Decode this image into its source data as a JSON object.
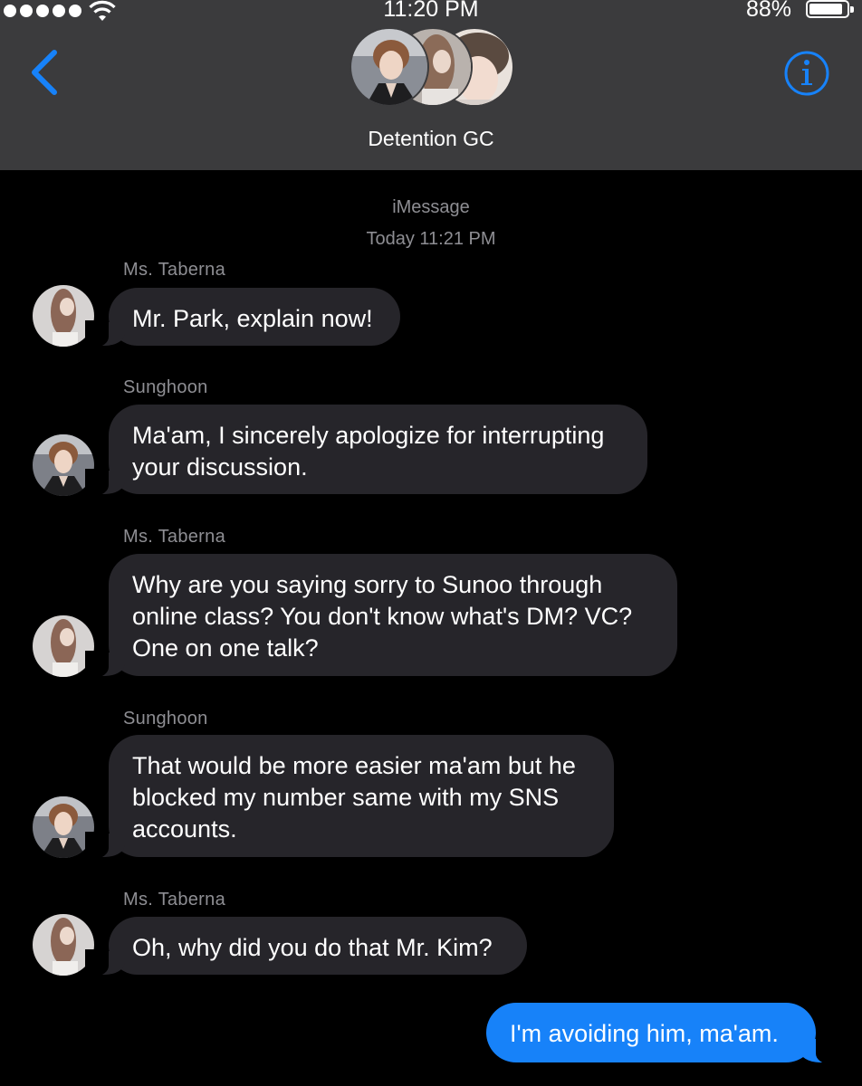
{
  "status_bar": {
    "time": "11:20 PM",
    "battery_percent": "88%"
  },
  "nav": {
    "back_icon": "chevron-left-icon",
    "info_icon": "info-icon",
    "accent_color": "#1782f9"
  },
  "chat": {
    "title": "Detention GC",
    "service": "iMessage",
    "timestamp": "Today 11:21 PM"
  },
  "messages": [
    {
      "sender": "Ms. Taberna",
      "text": "Mr. Park, explain now!",
      "direction": "incoming"
    },
    {
      "sender": "Sunghoon",
      "text": "Ma'am, I sincerely apologize for interrupting your discussion.",
      "direction": "incoming"
    },
    {
      "sender": "Ms. Taberna",
      "text": "Why are you saying sorry to Sunoo through online class? You don't know what's DM? VC? One on one talk?",
      "direction": "incoming"
    },
    {
      "sender": "Sunghoon",
      "text": "That would be more easier ma'am but he blocked my number same with my SNS accounts.",
      "direction": "incoming"
    },
    {
      "sender": "Ms. Taberna",
      "text": "Oh, why did you do that Mr. Kim?",
      "direction": "incoming"
    },
    {
      "sender": "",
      "text": "I'm avoiding him, ma'am.",
      "direction": "outgoing"
    }
  ],
  "colors": {
    "header_bg": "#3b3b3d",
    "incoming_bubble": "#26252a",
    "outgoing_bubble": "#1782f9",
    "meta_text": "#8e8e93"
  }
}
